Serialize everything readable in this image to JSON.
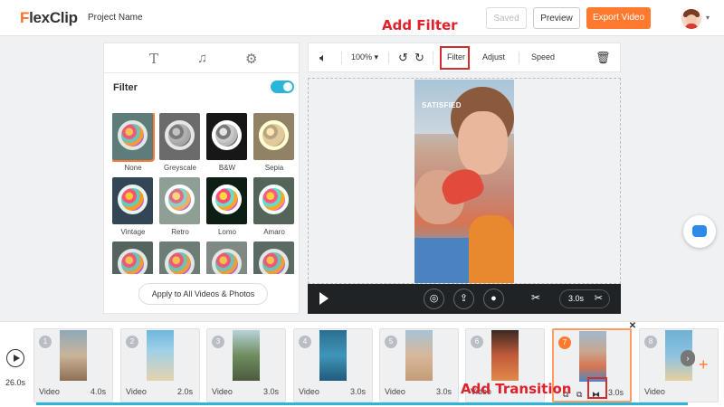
{
  "header": {
    "logo": "FlexClip",
    "project_name": "Project Name",
    "saved_label": "Saved",
    "preview_label": "Preview",
    "export_label": "Export Video"
  },
  "annotations": {
    "filter": "Add Filter",
    "transition": "Add Transition"
  },
  "panel": {
    "tabs": [
      "text-icon",
      "music-icon",
      "settings-icon"
    ],
    "filter_title": "Filter",
    "filter_enabled": true,
    "filters": [
      "None",
      "Greyscale",
      "B&W",
      "Sepia",
      "Vintage",
      "Retro",
      "Lomo",
      "Amaro"
    ],
    "apply_label": "Apply to All Videos & Photos"
  },
  "toolbar": {
    "zoom": "100%",
    "filter_label": "Filter",
    "adjust_label": "Adjust",
    "speed_label": "Speed"
  },
  "video": {
    "caption": "SATISFIED"
  },
  "player": {
    "duration": "3.0s"
  },
  "timeline": {
    "total": "26.0s",
    "clips": [
      {
        "num": "1",
        "type": "Video",
        "len": "4.0s"
      },
      {
        "num": "2",
        "type": "Video",
        "len": "2.0s"
      },
      {
        "num": "3",
        "type": "Video",
        "len": "3.0s"
      },
      {
        "num": "4",
        "type": "Video",
        "len": "3.0s"
      },
      {
        "num": "5",
        "type": "Video",
        "len": "3.0s"
      },
      {
        "num": "6",
        "type": "Video",
        "len": ""
      },
      {
        "num": "7",
        "type": "",
        "len": "3.0s"
      },
      {
        "num": "8",
        "type": "Video",
        "len": ""
      }
    ]
  },
  "colors": {
    "accent": "#ff7a2e",
    "toggle": "#2bb5d8",
    "annotation": "#e0202a"
  }
}
